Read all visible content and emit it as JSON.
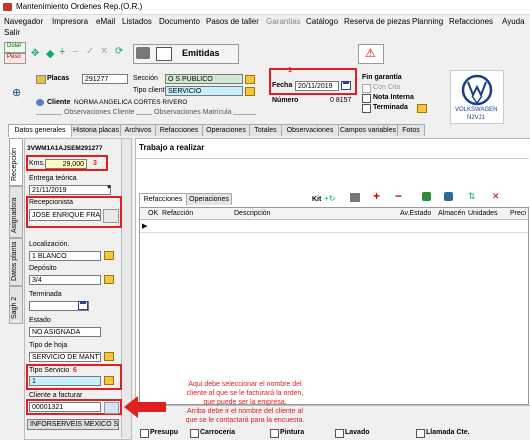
{
  "window": {
    "title": "Mantenimiento Ordenes Rep.(O.R.)"
  },
  "menu": {
    "items": [
      "Navegador",
      "Impresora",
      "eMail",
      "Listados",
      "Documento",
      "Pasos de taller",
      "Garantias",
      "Catálogo",
      "Reserva de piezas",
      "Planning",
      "Refacciones",
      "Ayuda"
    ],
    "salir": "Salir"
  },
  "toolbar": {
    "dolar": "Dolar",
    "peso": "Peso",
    "status": "Emitidas"
  },
  "header": {
    "placas_label": "Placas",
    "placas_value": "291277",
    "seccion_label": "Sección",
    "seccion_value": "O S PUBLICO",
    "tipo_cliente_label": "Tipo cliente",
    "tipo_cliente_value": "SERVICIO",
    "cliente_label": "Cliente",
    "cliente_value": "NORMA ANGELICA CORTES RIVERO",
    "obs_cliente": "Observaciones Cliente",
    "obs_matricula": "Observaciones Matrícula",
    "fecha_label": "Fecha",
    "fecha_value": "20/11/2019",
    "fecha_badge": "1",
    "numero_label": "Número",
    "numero_value": "0 8157",
    "fin_garantia": "Fin garantía",
    "con_cita": "Con Cita",
    "nota_interna": "Nota Interna",
    "terminada": "Terminada",
    "vw_line1": "VOLKSWAGEN",
    "vw_line2": "N2VJ1"
  },
  "tabs": [
    "Datos generales",
    "Historia placas",
    "Archivos",
    "Refacciones",
    "Operaciones",
    "Totales",
    "Observaciones",
    "Campos variables",
    "Fotos"
  ],
  "side_tabs": [
    "Recepción",
    "Asignadora",
    "Datos planta",
    "Sagh 2"
  ],
  "left_panel": {
    "vin": "3VWM1A1AJSEM291277",
    "kms_label": "Kms.",
    "kms_value": "29,000",
    "kms_badge": "3",
    "entrega_label": "Entrega teórica",
    "entrega_value": "21/11/2019",
    "recepcionista_label": "Recepcionista",
    "recepcionista_value": "JOSE ENRIQUE FRAN",
    "localizacion_label": "Localización.",
    "localizacion_value": "1 BLANCO",
    "deposito_label": "Depósito",
    "deposito_value": "3/4",
    "terminada_label": "Terminada",
    "estado_label": "Estado",
    "estado_value": "NO ASIGNADA",
    "tipo_hoja_label": "Tipo de hoja",
    "tipo_hoja_value": "SERVICIO DE MANTT",
    "tipo_servicio_label": "Tipo Servicio",
    "tipo_servicio_value": "1",
    "tipo_servicio_badge": "6",
    "cliente_facturar_label": "Cliente a facturar",
    "cliente_facturar_value": "00001321",
    "cliente_facturar_name": "INFORSERVEIS MEXICO S"
  },
  "right_panel": {
    "title": "Trabajo a realizar",
    "sub_tabs": [
      "Refacciones",
      "Operaciones"
    ],
    "kit_label": "Kit",
    "columns": [
      "OK",
      "Refacción",
      "Descripción",
      "Av.Estado",
      "Almacén",
      "Unidades",
      "Preci"
    ]
  },
  "annotation": {
    "lines": [
      "Aqui debe seleccionar el nombre del",
      "cliente al que se le facturará la orden,",
      "que puede ser la empresa.",
      "Arriba debe ir el nombre del cliente al",
      "que se le contactará para la encuesta."
    ]
  },
  "footer": {
    "items": [
      "Presupu",
      "Carroceria",
      "Pintura",
      "Lavado",
      "Llamada Cte."
    ]
  }
}
